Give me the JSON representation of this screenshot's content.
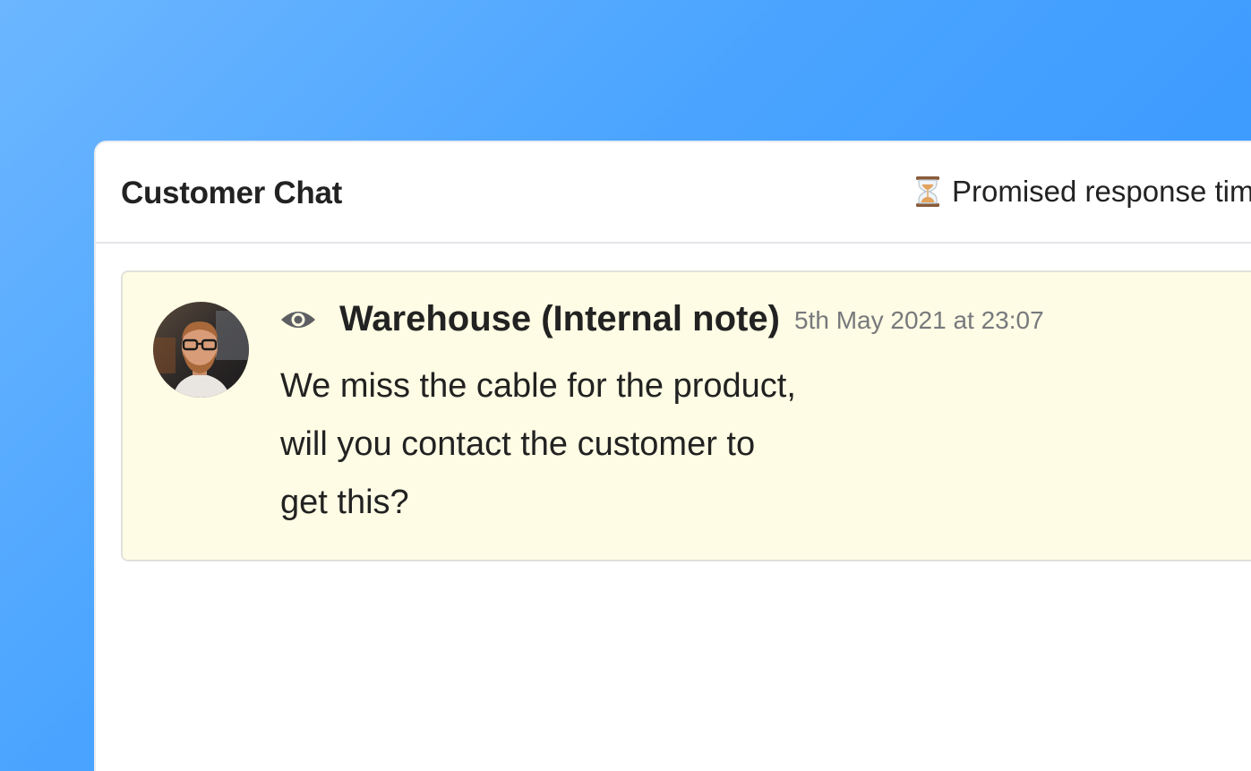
{
  "chat": {
    "title": "Customer Chat",
    "response_time_label": "Promised response tim",
    "response_icon": "hourglass-icon"
  },
  "note": {
    "author": "Warehouse (Internal note)",
    "timestamp": "5th May 2021 at 23:07",
    "visibility_icon": "eye-icon",
    "message_lines": [
      "We miss the cable for the product,",
      "will you contact the customer to",
      "get this?"
    ]
  },
  "colors": {
    "background_gradient_start": "#6cb6ff",
    "background_gradient_end": "#3a96ff",
    "note_background": "#fefce4",
    "timestamp": "#77797d",
    "text": "#222222"
  }
}
